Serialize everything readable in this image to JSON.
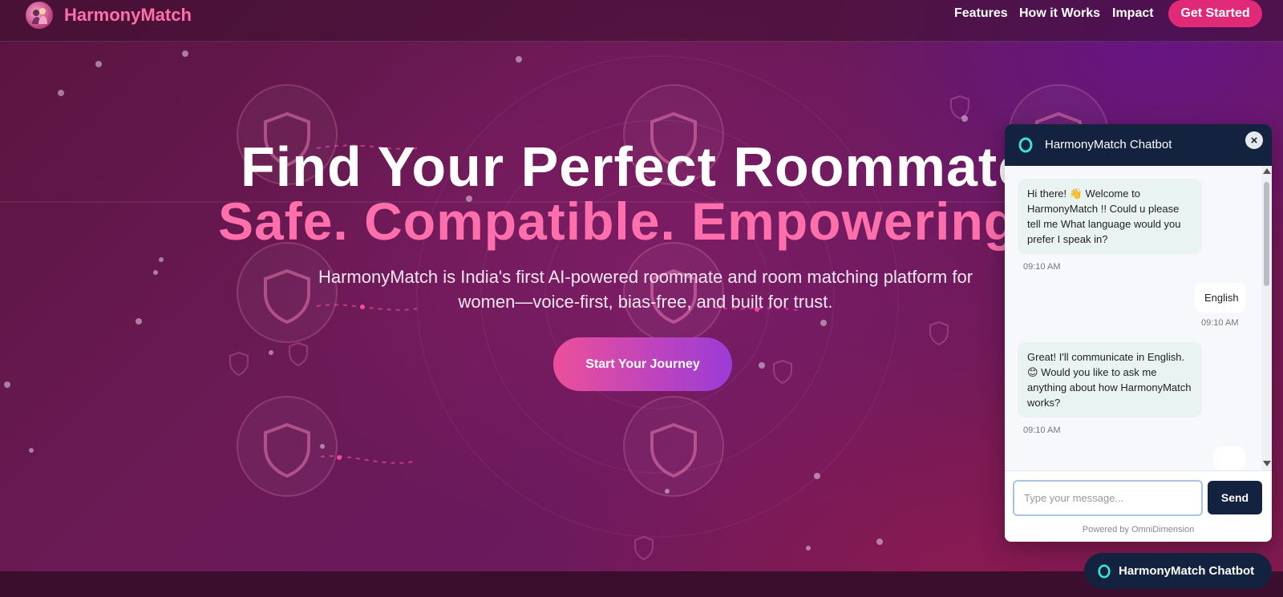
{
  "brand": {
    "name": "HarmonyMatch"
  },
  "nav": {
    "links": [
      "Features",
      "How it Works",
      "Impact"
    ],
    "cta": "Get Started"
  },
  "hero": {
    "title_line1": "Find Your Perfect Roommate",
    "title_line2": "Safe. Compatible. Empowering.",
    "subtitle": "HarmonyMatch is India's first AI-powered roommate and room matching platform for women—voice-first, bias-free, and built for trust.",
    "cta": "Start Your Journey"
  },
  "chatbot": {
    "title": "HarmonyMatch Chatbot",
    "close_icon": "×",
    "messages": [
      {
        "from": "bot",
        "text": "Hi there! 👋 Welcome to HarmonyMatch !! Could u please tell me What language would you prefer I speak in?",
        "time": "09:10 AM"
      },
      {
        "from": "user",
        "text": "English",
        "time": "09:10 AM"
      },
      {
        "from": "bot",
        "text": "Great! I'll communicate in English. 😊 Would you like to ask me anything about how HarmonyMatch works?",
        "time": "09:10 AM"
      }
    ],
    "input_placeholder": "Type your message...",
    "send_label": "Send",
    "powered_by": "Powered by OmniDimension",
    "launcher_label": "HarmonyMatch Chatbot"
  },
  "colors": {
    "accent_pink": "#ff6fab",
    "nav_cta": "#e02a78",
    "chat_navy": "#13223e",
    "bot_bubble": "#e8f3f2"
  }
}
